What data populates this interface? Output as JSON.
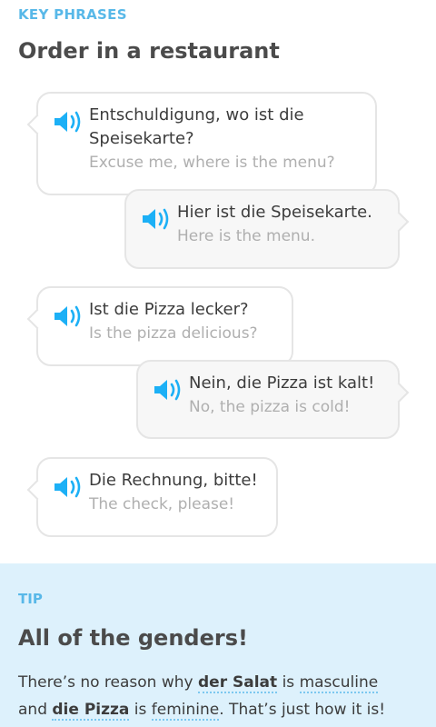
{
  "header": {
    "section_label": "KEY PHRASES",
    "title": "Order in a restaurant"
  },
  "dialogue": [
    {
      "side": "left",
      "phrase": "Entschuldigung, wo ist die Speisekarte?",
      "translation": "Excuse me, where is the menu?"
    },
    {
      "side": "right",
      "phrase": "Hier ist die Speisekarte.",
      "translation": "Here is the menu."
    },
    {
      "side": "left",
      "phrase": "Ist die Pizza lecker?",
      "translation": "Is the pizza delicious?"
    },
    {
      "side": "right",
      "phrase": "Nein, die Pizza ist kalt!",
      "translation": "No, the pizza is cold!"
    },
    {
      "side": "left",
      "phrase": "Die Rechnung, bitte!",
      "translation": "The check, please!"
    }
  ],
  "tip": {
    "label": "TIP",
    "title": "All of the genders!",
    "line1": {
      "pre": "There’s no reason why ",
      "term1": "der Salat",
      "mid": " is ",
      "word1": "masculine"
    },
    "line2": {
      "pre": "and ",
      "term2": "die Pizza",
      "mid": " is ",
      "word2": "feminine",
      "post": ". That’s just how it is!"
    }
  },
  "colors": {
    "accent": "#58b8e8",
    "speaker_icon": "#1cb0f6",
    "tip_background": "#ddf1fc",
    "bubble_border": "#e5e5e5",
    "translation_text": "#afafaf"
  },
  "icons": {
    "speaker": "speaker-icon"
  }
}
